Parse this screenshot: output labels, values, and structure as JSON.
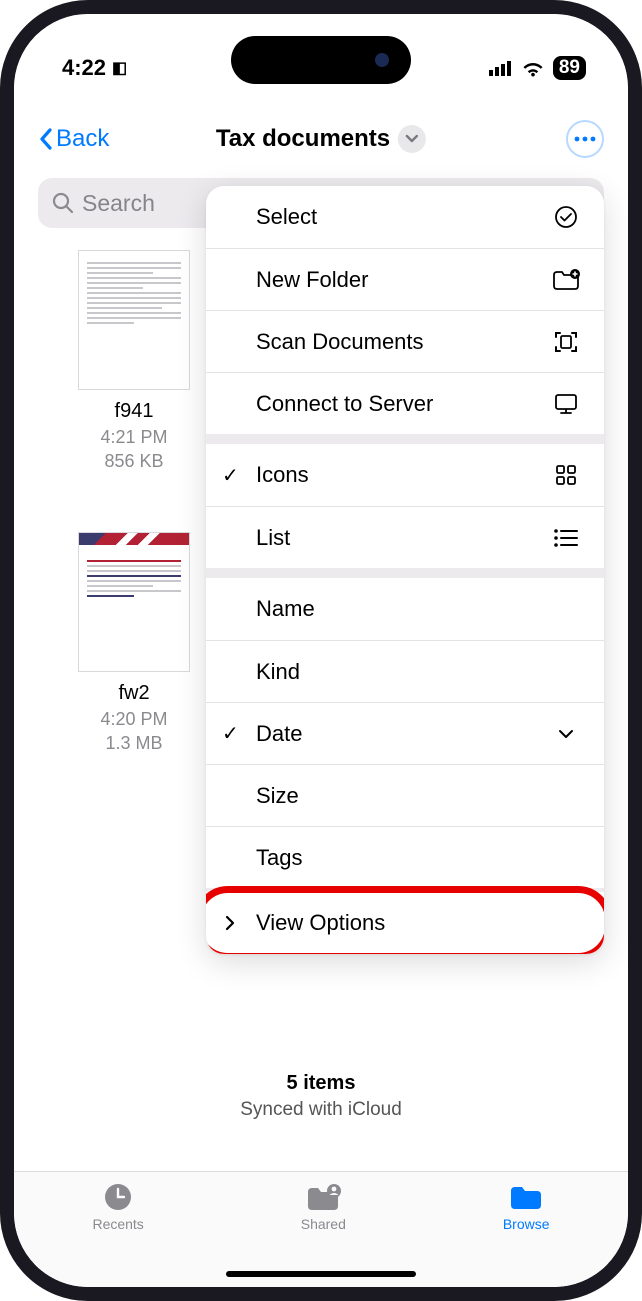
{
  "status": {
    "time": "4:22",
    "battery": "89"
  },
  "nav": {
    "back": "Back",
    "title": "Tax documents"
  },
  "search": {
    "placeholder": "Search"
  },
  "files": [
    {
      "name": "f941",
      "time": "4:21 PM",
      "size": "856 KB"
    },
    {
      "name": "fw2",
      "time": "4:20 PM",
      "size": "1.3 MB"
    }
  ],
  "menu": {
    "select": "Select",
    "new_folder": "New Folder",
    "scan": "Scan Documents",
    "connect": "Connect to Server",
    "icons": "Icons",
    "list": "List",
    "name": "Name",
    "kind": "Kind",
    "date": "Date",
    "size": "Size",
    "tags": "Tags",
    "view_options": "View Options"
  },
  "summary": {
    "count": "5 items",
    "sync": "Synced with iCloud"
  },
  "tabs": {
    "recents": "Recents",
    "shared": "Shared",
    "browse": "Browse"
  }
}
